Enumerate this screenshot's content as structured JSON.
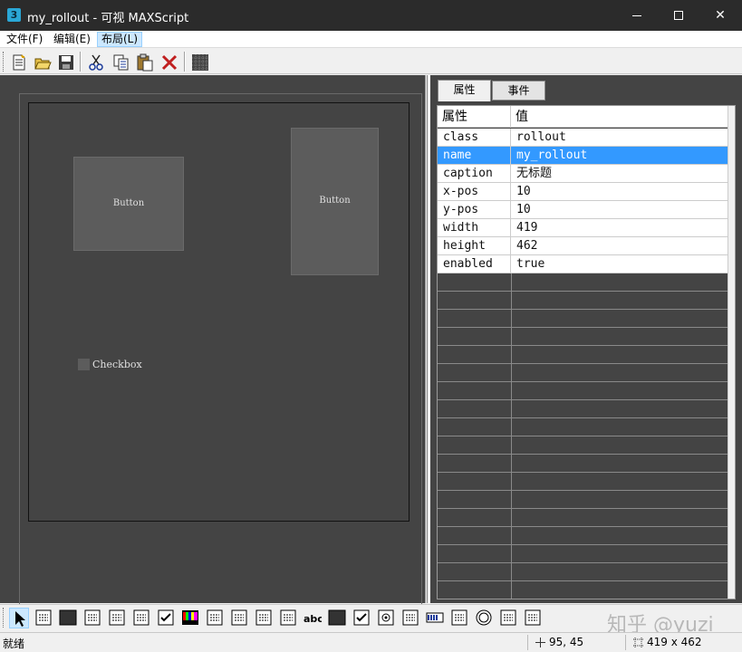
{
  "window": {
    "title": "my_rollout - 可视 MAXScript",
    "app_icon_text": "3"
  },
  "menu": {
    "file": "文件(F)",
    "edit": "编辑(E)",
    "layout": "布局(L)"
  },
  "toolbar": {
    "buttons": [
      "new-icon",
      "open-icon",
      "save-icon",
      "cut-icon",
      "copy-icon",
      "paste-icon",
      "delete-icon",
      "grid-icon"
    ]
  },
  "canvas": {
    "button1_label": "Button",
    "button2_label": "Button",
    "checkbox_label": "Checkbox"
  },
  "tabs": {
    "properties": "属性",
    "events": "事件"
  },
  "grid": {
    "header_property": "属性",
    "header_value": "值",
    "rows": [
      {
        "name": "class",
        "value": "rollout"
      },
      {
        "name": "name",
        "value": "my_rollout"
      },
      {
        "name": "caption",
        "value": "无标题"
      },
      {
        "name": "x-pos",
        "value": "10"
      },
      {
        "name": "y-pos",
        "value": "10"
      },
      {
        "name": "width",
        "value": "419"
      },
      {
        "name": "height",
        "value": "462"
      },
      {
        "name": "enabled",
        "value": "true"
      }
    ],
    "selected_row": "name"
  },
  "controls_toolbar": {
    "items": [
      "pointer-icon",
      "bitmap-icon",
      "label-icon",
      "image-button-icon",
      "color-picker-icon",
      "button-icon",
      "checkbutton-icon",
      "colorswatch-icon",
      "listbox-icon",
      "multilist-icon",
      "combobox-icon",
      "edittext-icon",
      "label-abc-icon",
      "groupbox-icon",
      "checkbox-icon",
      "radiobutton-icon",
      "spinner-icon",
      "progressbar-icon",
      "slider-icon",
      "timer-icon",
      "activex-icon",
      "mapbutton-icon"
    ],
    "label_abc": "abc"
  },
  "watermark": "知乎 @yuzi",
  "status": {
    "text": "就绪",
    "position": "95, 45",
    "size": "419 x 462"
  },
  "colors": {
    "titlebar": "#2b2b2b",
    "canvas": "#444444",
    "selection": "#3399ff"
  }
}
